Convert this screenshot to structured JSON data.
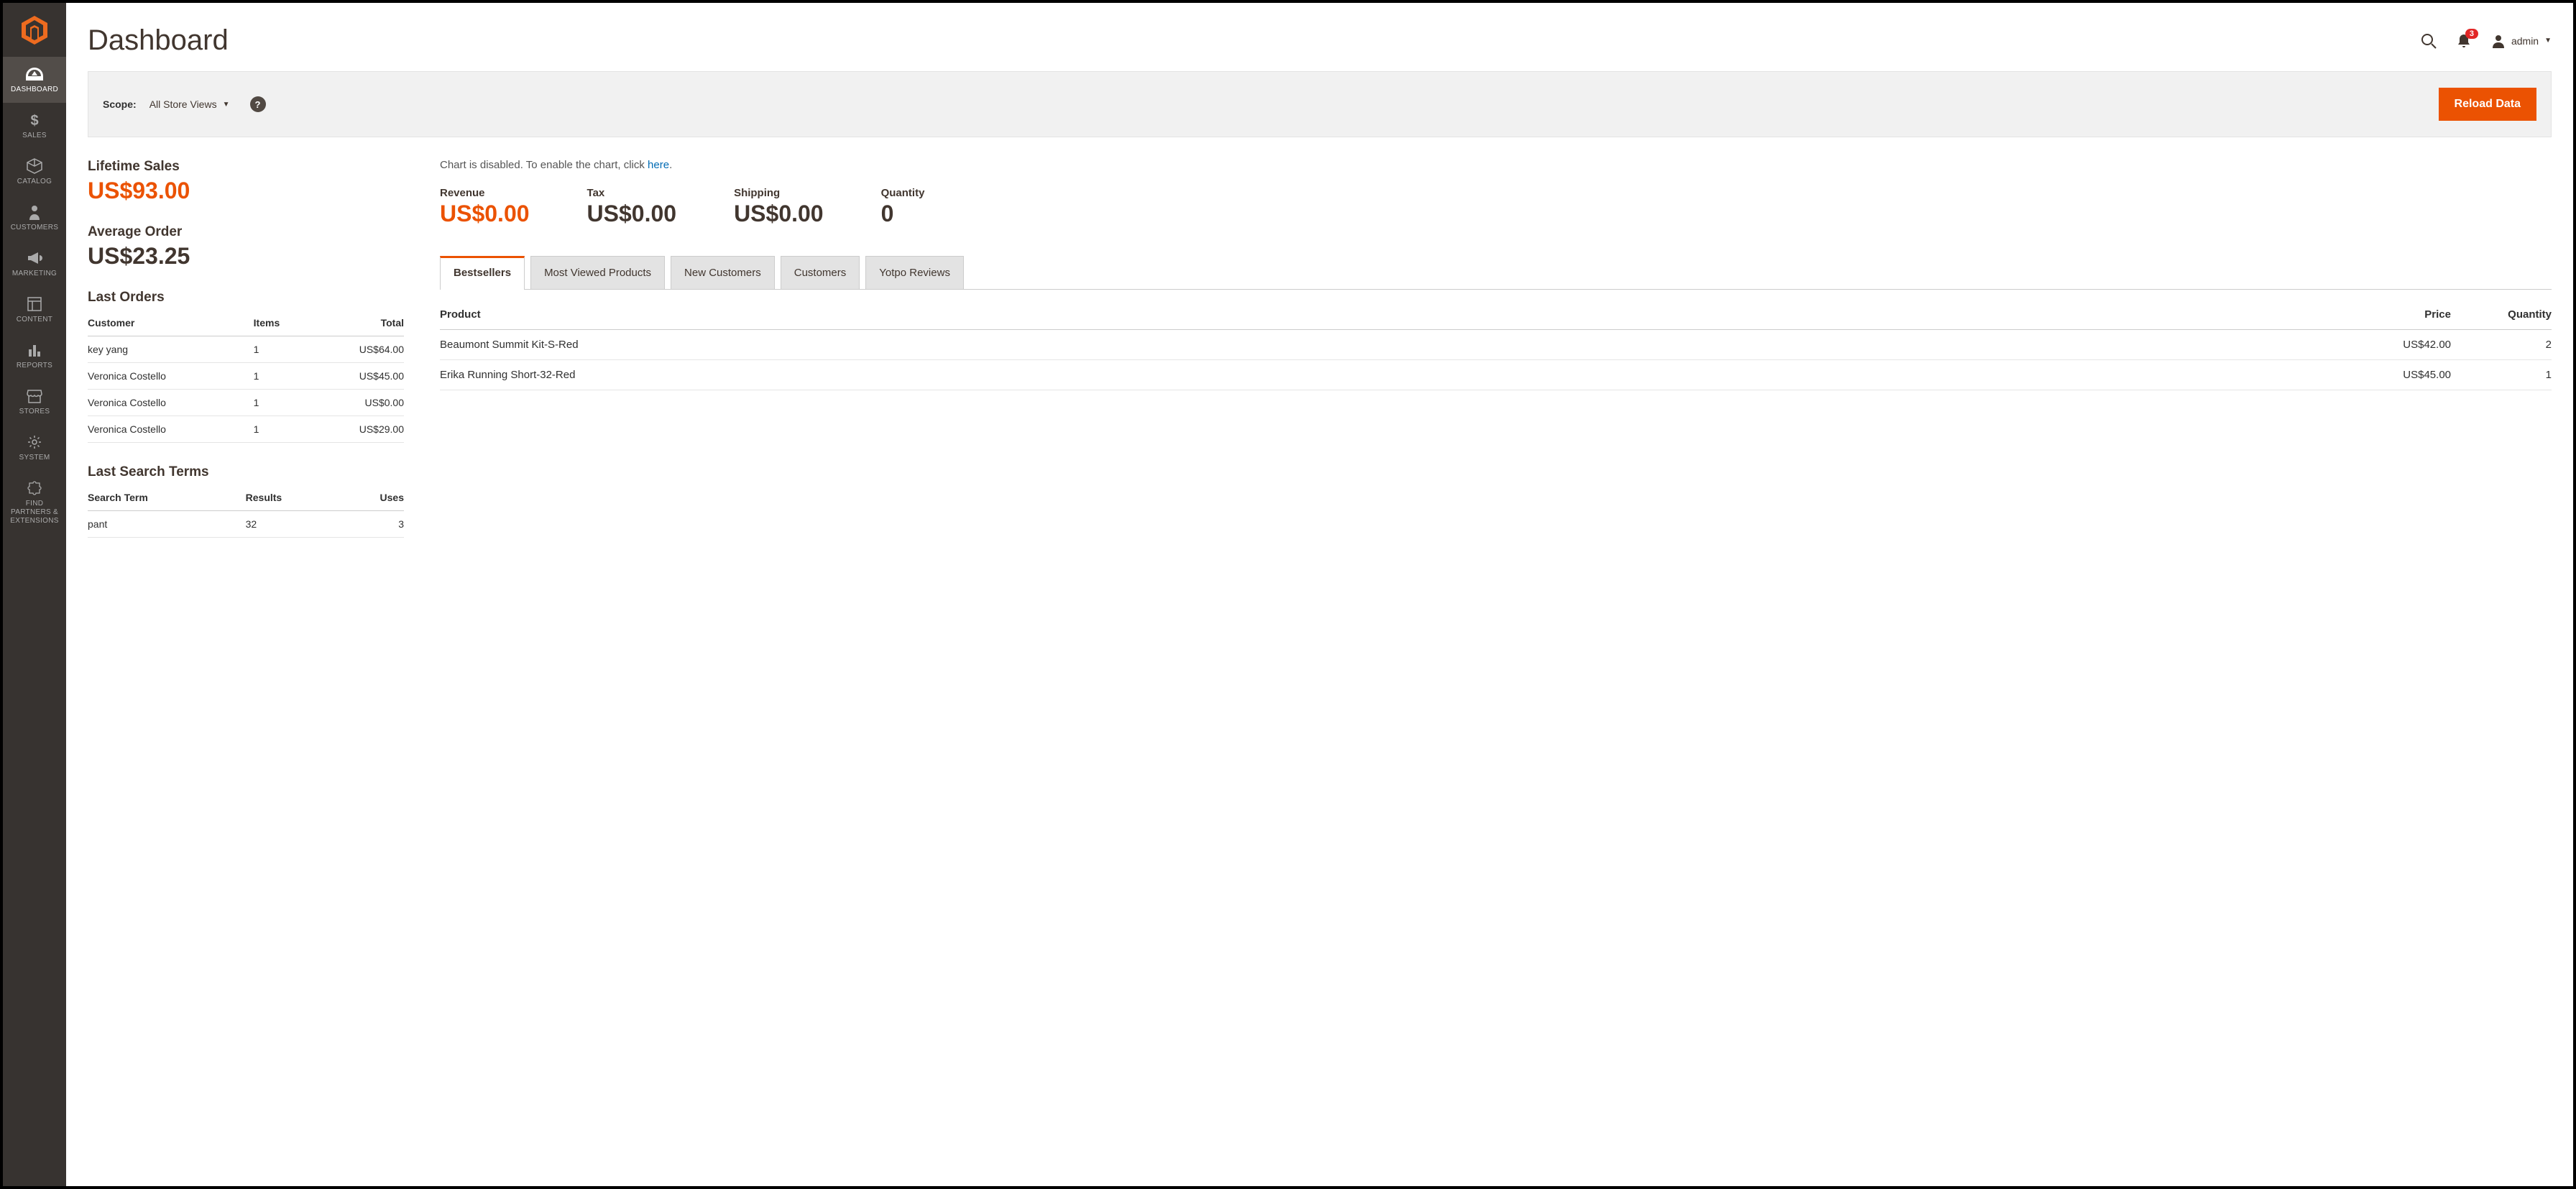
{
  "header": {
    "title": "Dashboard",
    "notification_count": "3",
    "user_name": "admin"
  },
  "sidebar": {
    "items": [
      {
        "label": "DASHBOARD"
      },
      {
        "label": "SALES"
      },
      {
        "label": "CATALOG"
      },
      {
        "label": "CUSTOMERS"
      },
      {
        "label": "MARKETING"
      },
      {
        "label": "CONTENT"
      },
      {
        "label": "REPORTS"
      },
      {
        "label": "STORES"
      },
      {
        "label": "SYSTEM"
      },
      {
        "label": "FIND PARTNERS & EXTENSIONS"
      }
    ]
  },
  "scope": {
    "label": "Scope:",
    "value": "All Store Views",
    "reload_label": "Reload Data"
  },
  "lifetime_sales": {
    "title": "Lifetime Sales",
    "value": "US$93.00"
  },
  "average_order": {
    "title": "Average Order",
    "value": "US$23.25"
  },
  "last_orders": {
    "title": "Last Orders",
    "columns": {
      "customer": "Customer",
      "items": "Items",
      "total": "Total"
    },
    "rows": [
      {
        "customer": "key yang",
        "items": "1",
        "total": "US$64.00"
      },
      {
        "customer": "Veronica Costello",
        "items": "1",
        "total": "US$45.00"
      },
      {
        "customer": "Veronica Costello",
        "items": "1",
        "total": "US$0.00"
      },
      {
        "customer": "Veronica Costello",
        "items": "1",
        "total": "US$29.00"
      }
    ]
  },
  "last_search": {
    "title": "Last Search Terms",
    "columns": {
      "term": "Search Term",
      "results": "Results",
      "uses": "Uses"
    },
    "rows": [
      {
        "term": "pant",
        "results": "32",
        "uses": "3"
      }
    ]
  },
  "chart_notice": {
    "prefix": "Chart is disabled. To enable the chart, click ",
    "link": "here",
    "suffix": "."
  },
  "metrics": {
    "revenue": {
      "label": "Revenue",
      "value": "US$0.00"
    },
    "tax": {
      "label": "Tax",
      "value": "US$0.00"
    },
    "shipping": {
      "label": "Shipping",
      "value": "US$0.00"
    },
    "quantity": {
      "label": "Quantity",
      "value": "0"
    }
  },
  "tabs": [
    {
      "label": "Bestsellers"
    },
    {
      "label": "Most Viewed Products"
    },
    {
      "label": "New Customers"
    },
    {
      "label": "Customers"
    },
    {
      "label": "Yotpo Reviews"
    }
  ],
  "bestsellers": {
    "columns": {
      "product": "Product",
      "price": "Price",
      "quantity": "Quantity"
    },
    "rows": [
      {
        "product": "Beaumont Summit Kit-S-Red",
        "price": "US$42.00",
        "quantity": "2"
      },
      {
        "product": "Erika Running Short-32-Red",
        "price": "US$45.00",
        "quantity": "1"
      }
    ]
  }
}
